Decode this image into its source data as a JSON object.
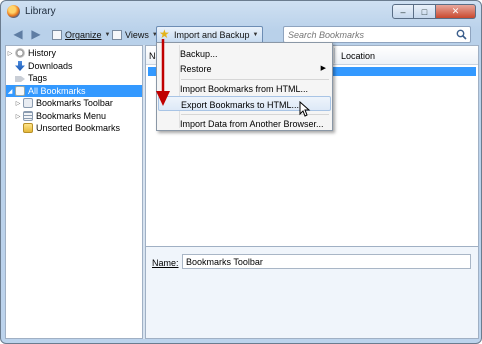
{
  "window": {
    "title": "Library",
    "controls": {
      "minimize": "–",
      "maximize": "□",
      "close": "✕"
    }
  },
  "toolbar": {
    "back_icon": "back-arrow-icon",
    "forward_icon": "forward-arrow-icon",
    "organize": "Organize",
    "views": "Views",
    "import_backup": "Import and Backup",
    "search_placeholder": "Search Bookmarks"
  },
  "sidebar": {
    "items": [
      {
        "label": "History",
        "icon": "clock-icon"
      },
      {
        "label": "Downloads",
        "icon": "download-arrow-icon"
      },
      {
        "label": "Tags",
        "icon": "tag-icon"
      },
      {
        "label": "All Bookmarks",
        "icon": "bookmarks-folder-icon",
        "selected": true
      },
      {
        "label": "Bookmarks Toolbar",
        "icon": "toolbar-folder-icon"
      },
      {
        "label": "Bookmarks Menu",
        "icon": "menu-folder-icon"
      },
      {
        "label": "Unsorted Bookmarks",
        "icon": "unsorted-folder-icon"
      }
    ]
  },
  "list": {
    "columns": [
      "Na",
      "Location"
    ]
  },
  "details": {
    "name_label": "Name:",
    "name_value": "Bookmarks Toolbar"
  },
  "menu": {
    "items": [
      "Backup...",
      "Restore",
      "Import Bookmarks from HTML...",
      "Export Bookmarks to HTML...",
      "Import Data from Another Browser..."
    ]
  },
  "colors": {
    "selection": "#3399ff",
    "annotation_arrow": "#c00000",
    "window_chrome": "#bcd3ec"
  }
}
